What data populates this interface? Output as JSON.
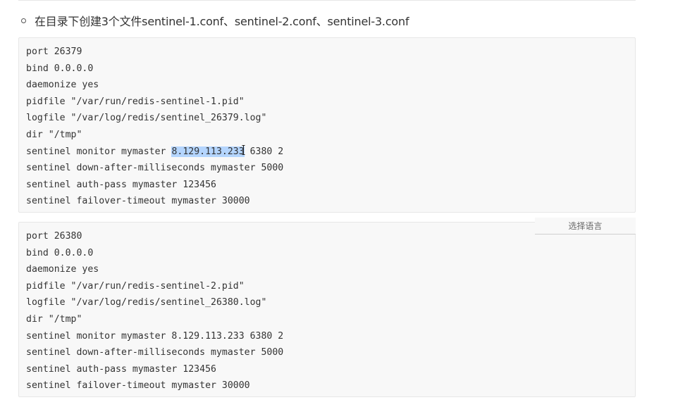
{
  "list_item": {
    "text": "在目录下创建3个文件sentinel-1.conf、sentinel-2.conf、sentinel-3.conf"
  },
  "code_block_1": {
    "lines": [
      "port 26379",
      "bind 0.0.0.0",
      "daemonize yes",
      "pidfile \"/var/run/redis-sentinel-1.pid\"",
      "logfile \"/var/log/redis/sentinel_26379.log\"",
      "dir \"/tmp\"",
      "sentinel monitor mymaster ",
      "sentinel down-after-milliseconds mymaster 5000",
      "sentinel auth-pass mymaster 123456",
      "sentinel failover-timeout mymaster 30000"
    ],
    "selected_text": "8.129.113.233",
    "after_selection": " 6380 2"
  },
  "code_block_2": {
    "lines": [
      "port 26380",
      "bind 0.0.0.0",
      "daemonize yes",
      "pidfile \"/var/run/redis-sentinel-2.pid\"",
      "logfile \"/var/log/redis/sentinel_26380.log\"",
      "dir \"/tmp\"",
      "sentinel monitor mymaster 8.129.113.233 6380 2",
      "sentinel down-after-milliseconds mymaster 5000",
      "sentinel auth-pass mymaster 123456",
      "sentinel failover-timeout mymaster 30000"
    ]
  },
  "language_selector": {
    "label": "选择语言"
  },
  "icons": {
    "list_bullet": "hollow-circle-bullet-icon",
    "cursor": "text-cursor-icon"
  },
  "colors": {
    "code_background": "#f8f8f8",
    "selection": "#b4d5fe",
    "text": "#333333"
  }
}
